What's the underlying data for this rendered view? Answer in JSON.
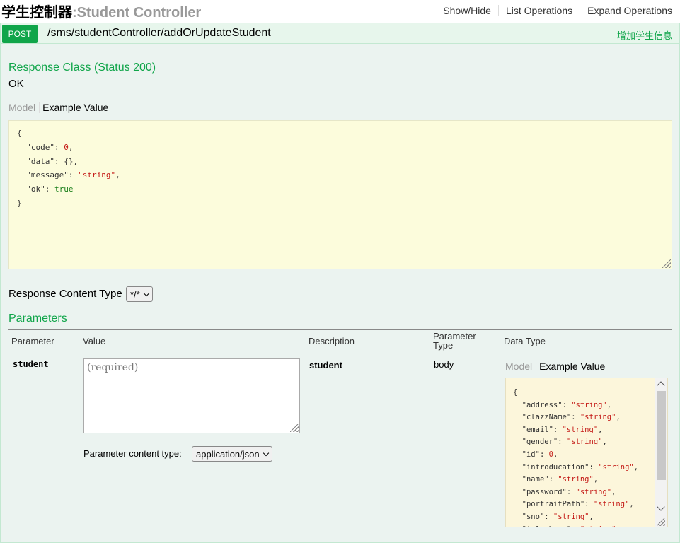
{
  "header": {
    "title_cn": "学生控制器",
    "separator": ":",
    "title_en": "Student Controller",
    "links": [
      "Show/Hide",
      "List Operations",
      "Expand Operations"
    ]
  },
  "operation": {
    "method": "POST",
    "path": "/sms/studentController/addOrUpdateStudent",
    "summary": "增加学生信息"
  },
  "response_class": {
    "heading": "Response Class (Status 200)",
    "status_text": "OK",
    "tabs": {
      "model": "Model",
      "example": "Example Value"
    },
    "example": [
      {
        "key": "\"code\"",
        "value": "0",
        "type": "number"
      },
      {
        "key": "\"data\"",
        "value": "{}",
        "type": "object"
      },
      {
        "key": "\"message\"",
        "value": "\"string\"",
        "type": "string"
      },
      {
        "key": "\"ok\"",
        "value": "true",
        "type": "bool"
      }
    ]
  },
  "response_content_type": {
    "label": "Response Content Type",
    "value": "*/*"
  },
  "parameters": {
    "heading": "Parameters",
    "columns": {
      "parameter": "Parameter",
      "value": "Value",
      "description": "Description",
      "parameter_type_line1": "Parameter",
      "parameter_type_line2": "Type",
      "data_type": "Data Type"
    },
    "row": {
      "name": "student",
      "value_placeholder": "(required)",
      "description": "student",
      "param_type": "body",
      "content_type_label": "Parameter content type:",
      "content_type_value": "application/json",
      "tabs": {
        "model": "Model",
        "example": "Example Value"
      },
      "example": [
        {
          "key": "\"address\"",
          "value": "\"string\"",
          "type": "string"
        },
        {
          "key": "\"clazzName\"",
          "value": "\"string\"",
          "type": "string"
        },
        {
          "key": "\"email\"",
          "value": "\"string\"",
          "type": "string"
        },
        {
          "key": "\"gender\"",
          "value": "\"string\"",
          "type": "string"
        },
        {
          "key": "\"id\"",
          "value": "0",
          "type": "number"
        },
        {
          "key": "\"introducation\"",
          "value": "\"string\"",
          "type": "string"
        },
        {
          "key": "\"name\"",
          "value": "\"string\"",
          "type": "string"
        },
        {
          "key": "\"password\"",
          "value": "\"string\"",
          "type": "string"
        },
        {
          "key": "\"portraitPath\"",
          "value": "\"string\"",
          "type": "string"
        },
        {
          "key": "\"sno\"",
          "value": "\"string\"",
          "type": "string"
        },
        {
          "key": "\"telephone\"",
          "value": "\"string\"",
          "type": "string"
        }
      ]
    }
  }
}
